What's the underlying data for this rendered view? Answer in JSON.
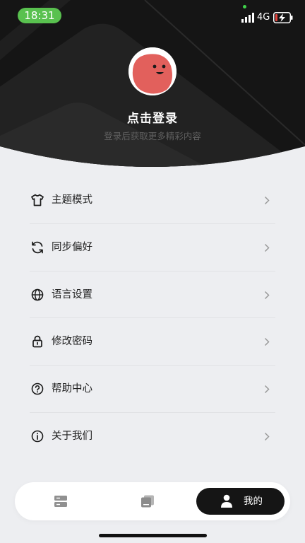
{
  "status_bar": {
    "time": "18:31",
    "network": "4G"
  },
  "profile": {
    "title": "点击登录",
    "subtitle": "登录后获取更多精彩内容"
  },
  "menu": [
    {
      "label": "主题模式",
      "icon": "tshirt-icon"
    },
    {
      "label": "同步偏好",
      "icon": "sync-icon"
    },
    {
      "label": "语言设置",
      "icon": "globe-icon"
    },
    {
      "label": "修改密码",
      "icon": "lock-icon"
    },
    {
      "label": "帮助中心",
      "icon": "help-icon"
    },
    {
      "label": "关于我们",
      "icon": "info-icon"
    }
  ],
  "tabbar": {
    "mine_label": "我的"
  },
  "colors": {
    "header_bg": "#151515",
    "page_bg": "#edeef1",
    "avatar_face": "#e2605c",
    "time_pill": "#59c14f"
  }
}
